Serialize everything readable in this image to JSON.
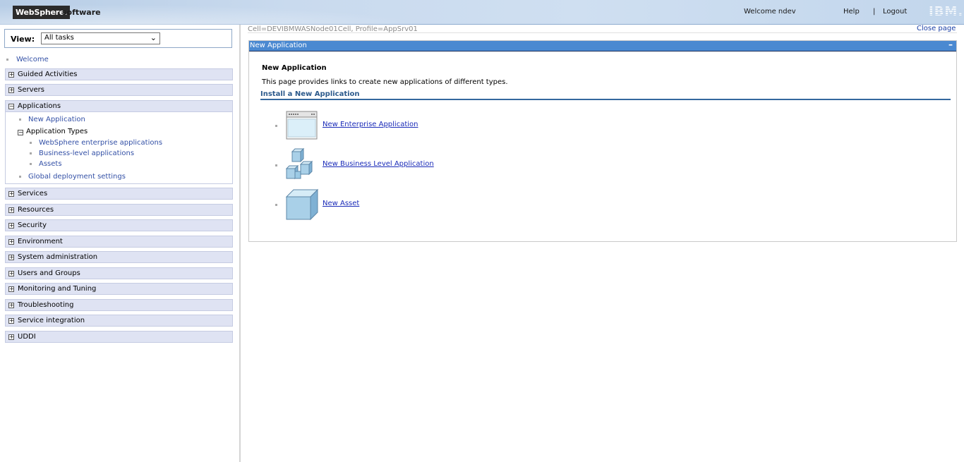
{
  "banner": {
    "brand": "WebSphere.",
    "product": "software",
    "welcome": "Welcome ndev",
    "help": "Help",
    "separator": "|",
    "logout": "Logout",
    "ibm": "IBM."
  },
  "nav": {
    "view_label": "View:",
    "view_value": "All tasks",
    "welcome": "Welcome",
    "sections": [
      {
        "label": "Guided Activities",
        "state": "+"
      },
      {
        "label": "Servers",
        "state": "+"
      },
      {
        "label": "Applications",
        "state": "−"
      },
      {
        "label": "Services",
        "state": "+"
      },
      {
        "label": "Resources",
        "state": "+"
      },
      {
        "label": "Security",
        "state": "+"
      },
      {
        "label": "Environment",
        "state": "+"
      },
      {
        "label": "System administration",
        "state": "+"
      },
      {
        "label": "Users and Groups",
        "state": "+"
      },
      {
        "label": "Monitoring and Tuning",
        "state": "+"
      },
      {
        "label": "Troubleshooting",
        "state": "+"
      },
      {
        "label": "Service integration",
        "state": "+"
      },
      {
        "label": "UDDI",
        "state": "+"
      }
    ],
    "applications": {
      "new_application": "New Application",
      "application_types": "Application Types",
      "application_types_state": "−",
      "types": [
        "WebSphere enterprise applications",
        "Business-level applications",
        "Assets"
      ],
      "global_deployment": "Global deployment settings"
    }
  },
  "main": {
    "breadcrumb": "Cell=DEVIBMWASNode01Cell, Profile=AppSrv01",
    "close_page": "Close page",
    "panel_title": "New Application",
    "minimize": "–",
    "heading": "New Application",
    "description": "This page provides links to create new applications of different types.",
    "install_heading": "Install a New Application",
    "items": [
      {
        "label": " New Enterprise Application",
        "icon": "enterprise-app-window-icon"
      },
      {
        "label": " New Business Level Application",
        "icon": "business-level-cubes-icon"
      },
      {
        "label": " New Asset",
        "icon": "asset-cube-icon"
      }
    ]
  },
  "colors": {
    "panel_header": "#4a89d1",
    "nav_section_bg": "#dfe3f3",
    "link": "#3350a6"
  }
}
